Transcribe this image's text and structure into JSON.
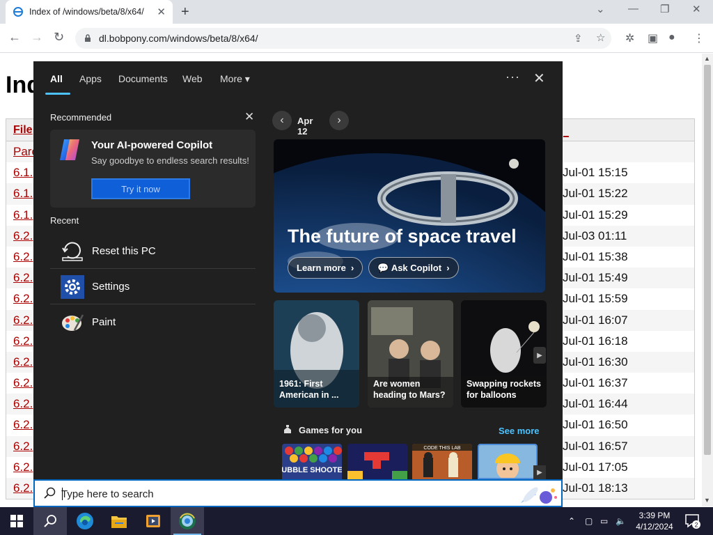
{
  "browser": {
    "tab_title": "Index of /windows/beta/8/x64/",
    "url": "dl.bobpony.com/windows/beta/8/x64/"
  },
  "page": {
    "heading": "Ind",
    "header_name": "File",
    "header_date": "_",
    "rows": [
      {
        "name": "Pare",
        "date": ""
      },
      {
        "name": "6.1.",
        "date": "Jul-01 15:15"
      },
      {
        "name": "6.1.",
        "date": "Jul-01 15:22"
      },
      {
        "name": "6.1.",
        "date": "Jul-01 15:29"
      },
      {
        "name": "6.2.",
        "date": "Jul-03 01:11"
      },
      {
        "name": "6.2.",
        "date": "Jul-01 15:38"
      },
      {
        "name": "6.2.",
        "date": "Jul-01 15:49"
      },
      {
        "name": "6.2.",
        "date": "Jul-01 15:59"
      },
      {
        "name": "6.2.",
        "date": "Jul-01 16:07"
      },
      {
        "name": "6.2.",
        "date": "Jul-01 16:18"
      },
      {
        "name": "6.2.",
        "date": "Jul-01 16:30"
      },
      {
        "name": "6.2.",
        "date": "Jul-01 16:37"
      },
      {
        "name": "6.2.",
        "date": "Jul-01 16:44"
      },
      {
        "name": "6.2.",
        "date": "Jul-01 16:50"
      },
      {
        "name": "6.2.",
        "date": "Jul-01 16:57"
      },
      {
        "name": "6.2.",
        "date": "Jul-01 17:05"
      },
      {
        "name": "6.2.",
        "date": "Jul-01 18:13"
      }
    ]
  },
  "search": {
    "tabs": [
      "All",
      "Apps",
      "Documents",
      "Web",
      "More"
    ],
    "more_arrow": "▾",
    "dots": "···",
    "close": "✕",
    "recommended_label": "Recommended",
    "copilot": {
      "title": "Your AI-powered Copilot",
      "subtitle": "Say goodbye to endless search results!",
      "button": "Try it now"
    },
    "recent_label": "Recent",
    "recent": [
      {
        "label": "Reset this PC",
        "icon": "reset-pc-icon"
      },
      {
        "label": "Settings",
        "icon": "gear-icon"
      },
      {
        "label": "Paint",
        "icon": "paint-palette-icon"
      }
    ],
    "date": "Apr 12",
    "hero": {
      "title": "The future of space travel",
      "learn_more": "Learn more",
      "ask_copilot": "Ask Copilot"
    },
    "cards": [
      {
        "title": "1961: First American in ..."
      },
      {
        "title": "Are women heading to Mars?"
      },
      {
        "title": "Swapping rockets for balloons"
      }
    ],
    "games_label": "Games for you",
    "see_more": "See more",
    "games": [
      "BUBBLE SHOOTER",
      "",
      "CODE THIS LAB",
      ""
    ],
    "placeholder": "Type here to search"
  },
  "taskbar": {
    "time": "3:39 PM",
    "date": "4/12/2024",
    "notifications": "2"
  },
  "colors": {
    "accent": "#4cc2ff",
    "flyout_bg": "#202020",
    "link": "#aa0000"
  }
}
